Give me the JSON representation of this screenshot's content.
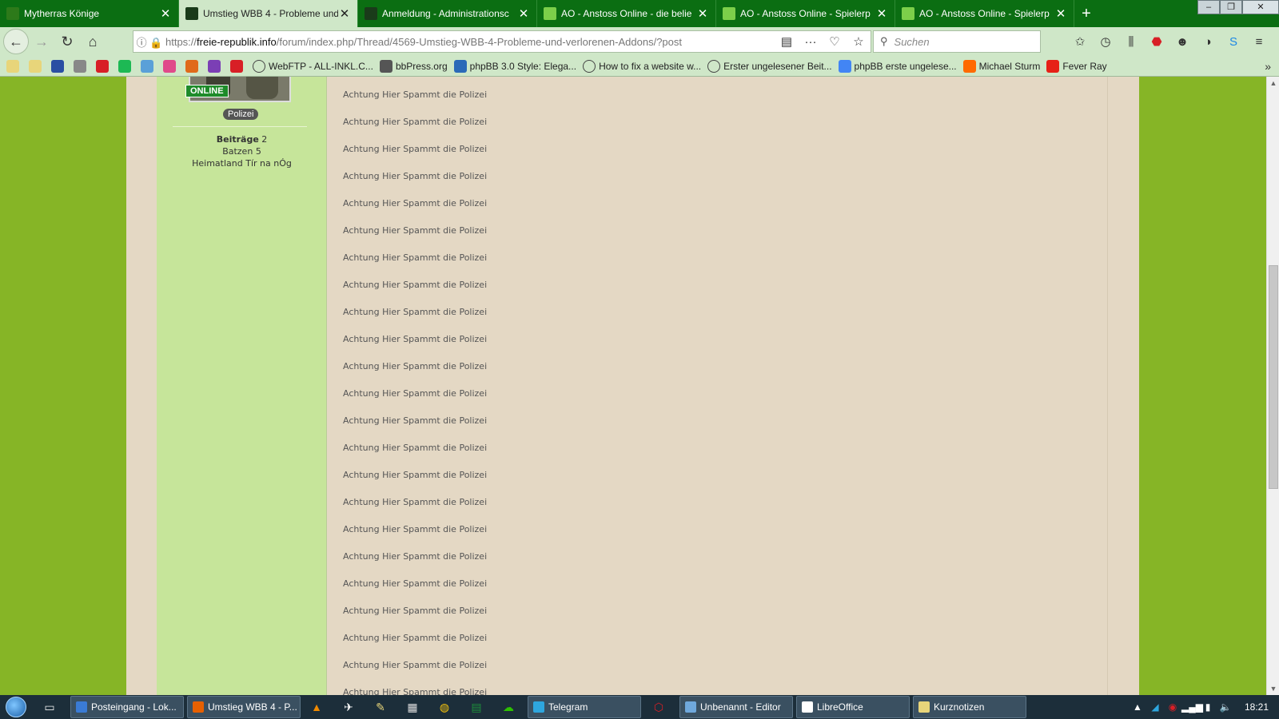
{
  "tabs": [
    {
      "title": "Mytherras Könige",
      "active": false,
      "fav_color": "#2d7a1a"
    },
    {
      "title": "Umstieg WBB 4 - Probleme und",
      "active": true,
      "fav_color": "#1a3b1a"
    },
    {
      "title": "Anmeldung - Administrationsc",
      "active": false,
      "fav_color": "#1a3b1a"
    },
    {
      "title": "AO - Anstoss Online - die belie",
      "active": false,
      "fav_color": "#7ccf4a"
    },
    {
      "title": "AO - Anstoss Online - Spielerp",
      "active": false,
      "fav_color": "#7ccf4a"
    },
    {
      "title": "AO - Anstoss Online - Spielerp",
      "active": false,
      "fav_color": "#7ccf4a"
    }
  ],
  "navbar": {
    "url_prefix": "https://",
    "url_domain": "freie-republik.info",
    "url_path": "/forum/index.php/Thread/4569-Umstieg-WBB-4-Probleme-und-verlorenen-Addons/?post",
    "search_placeholder": "Suchen"
  },
  "bookmarks": [
    {
      "label": "",
      "icon": "folder-icon",
      "color": "#e8d57a"
    },
    {
      "label": "",
      "icon": "folder-icon",
      "color": "#e8d57a"
    },
    {
      "label": "",
      "icon": "mp-icon",
      "color": "#2a4fa3"
    },
    {
      "label": "",
      "icon": "cs-icon",
      "color": "#888888"
    },
    {
      "label": "",
      "icon": "netflix-icon",
      "color": "#d81f26"
    },
    {
      "label": "",
      "icon": "spotify-icon",
      "color": "#1db954"
    },
    {
      "label": "",
      "icon": "bird-icon",
      "color": "#5aa0d8"
    },
    {
      "label": "",
      "icon": "cake-icon",
      "color": "#e04a8a"
    },
    {
      "label": "",
      "icon": "bottle-icon",
      "color": "#e06a1a"
    },
    {
      "label": "",
      "icon": "m-icon",
      "color": "#7b3fb5"
    },
    {
      "label": "",
      "icon": "huawei-icon",
      "color": "#d81f26"
    },
    {
      "label": "WebFTP - ALL-INKL.C...",
      "icon": "globe-icon",
      "color": "#444444"
    },
    {
      "label": "bbPress.org",
      "icon": "bbpress-icon",
      "color": "#555555"
    },
    {
      "label": "phpBB 3.0 Style: Elega...",
      "icon": "phpbb-icon",
      "color": "#2a6ab8"
    },
    {
      "label": "How to fix a website w...",
      "icon": "globe-icon",
      "color": "#444444"
    },
    {
      "label": "Erster ungelesener Beit...",
      "icon": "globe-icon",
      "color": "#444444"
    },
    {
      "label": "phpBB erste ungelese...",
      "icon": "google-icon",
      "color": "#4285f4"
    },
    {
      "label": "Michael Sturm",
      "icon": "soundcloud-icon",
      "color": "#ff6a00"
    },
    {
      "label": "Fever Ray",
      "icon": "youtube-icon",
      "color": "#e62117"
    }
  ],
  "sidebar": {
    "online_badge": "ONLINE",
    "rank": "Polizei",
    "stats": [
      {
        "key": "Beiträge",
        "value": "2"
      },
      {
        "key": "Batzen",
        "value": "5"
      },
      {
        "key": "Heimatland",
        "value": "Tír na nÓg"
      }
    ]
  },
  "posts": [
    "Achtung Hier Spammt die Polizei",
    "Achtung Hier Spammt die Polizei",
    "Achtung Hier Spammt die Polizei",
    "Achtung Hier Spammt die Polizei",
    "Achtung Hier Spammt die Polizei",
    "Achtung Hier Spammt die Polizei",
    "Achtung Hier Spammt die Polizei",
    "Achtung Hier Spammt die Polizei",
    "Achtung Hier Spammt die Polizei",
    "Achtung Hier Spammt die Polizei",
    "Achtung Hier Spammt die Polizei",
    "Achtung Hier Spammt die Polizei",
    "Achtung Hier Spammt die Polizei",
    "Achtung Hier Spammt die Polizei",
    "Achtung Hier Spammt die Polizei",
    "Achtung Hier Spammt die Polizei",
    "Achtung Hier Spammt die Polizei",
    "Achtung Hier Spammt die Polizei",
    "Achtung Hier Spammt die Polizei",
    "Achtung Hier Spammt die Polizei",
    "Achtung Hier Spammt die Polizei",
    "Achtung Hier Spammt die Polizei",
    "Achtung Hier Spammt die Polizei"
  ],
  "taskbar": {
    "items": [
      {
        "label": "Posteingang - Lok...",
        "color": "#3a7bd5",
        "width": 142
      },
      {
        "label": "Umstieg WBB 4 - P...",
        "color": "#e66000",
        "width": 142
      },
      {
        "label": "Telegram",
        "color": "#2ea6de",
        "width": 142
      },
      {
        "label": "Unbenannt - Editor",
        "color": "#6fa8dc",
        "width": 142
      },
      {
        "label": "LibreOffice",
        "color": "#ffffff",
        "width": 142
      },
      {
        "label": "Kurznotizen",
        "color": "#e8d57a",
        "width": 142
      }
    ],
    "clock": "18:21"
  }
}
